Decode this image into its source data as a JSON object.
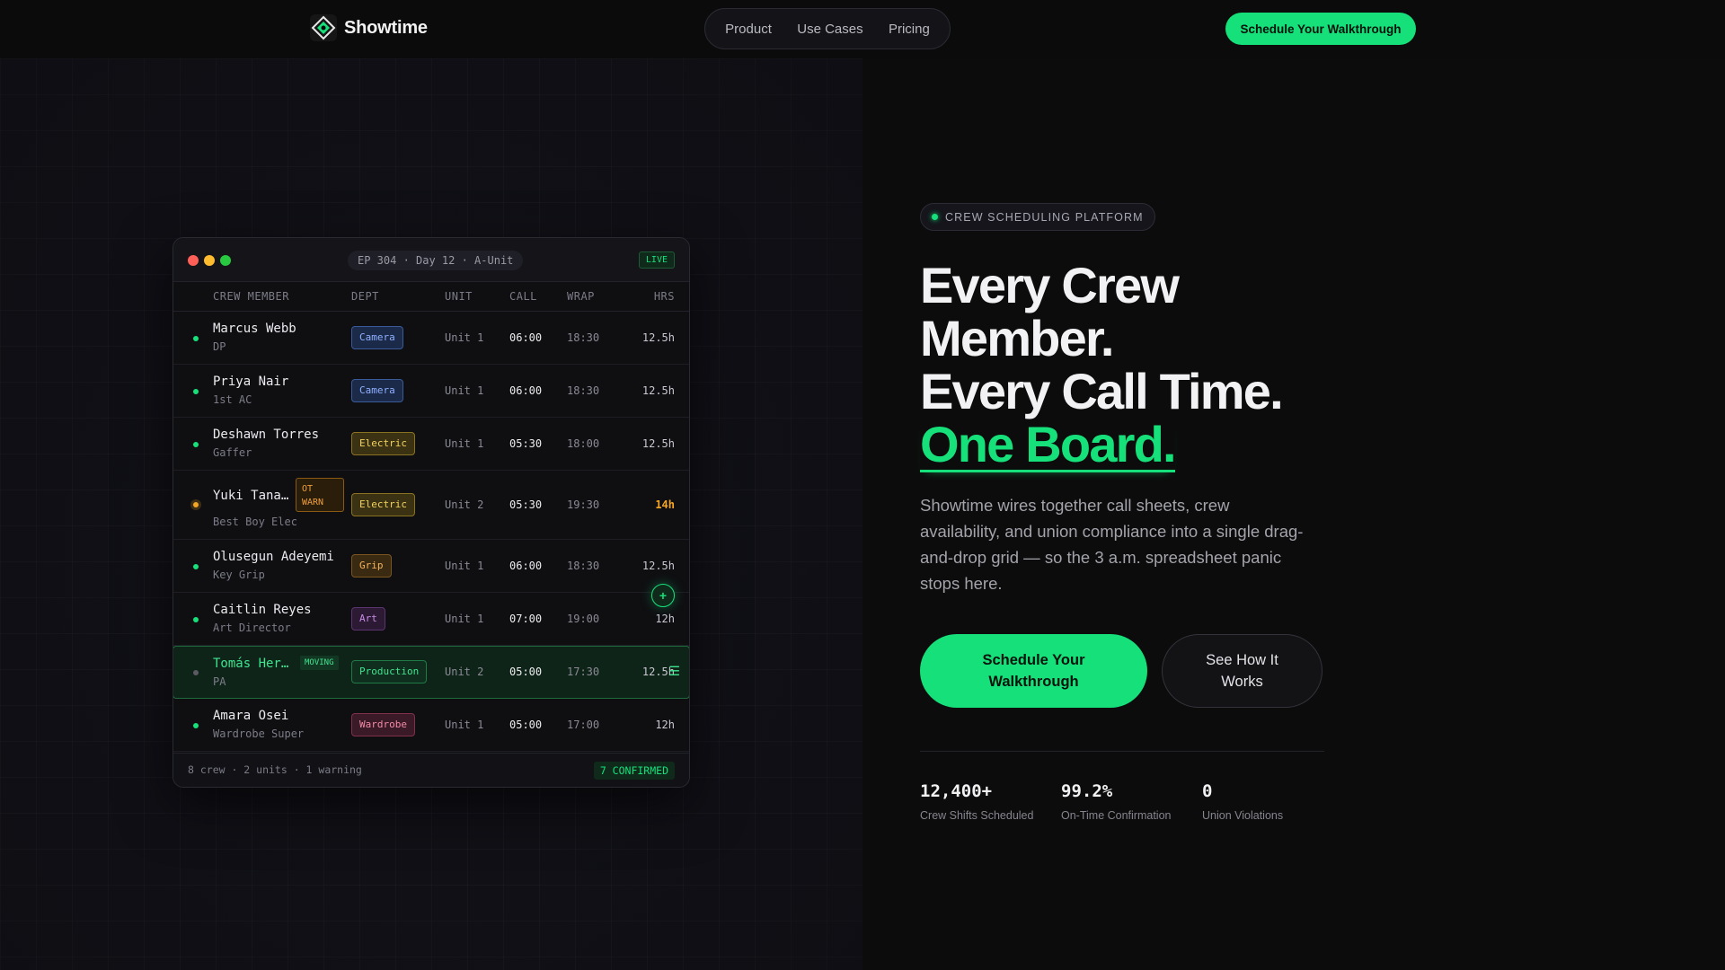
{
  "nav": {
    "brand": "Showtime",
    "links": [
      "Product",
      "Use Cases",
      "Pricing"
    ],
    "cta": "Schedule Your Walkthrough"
  },
  "board": {
    "episode": "EP 304 · Day 12 · A-Unit",
    "live": "LIVE",
    "columns": [
      "CREW MEMBER",
      "DEPT",
      "UNIT",
      "CALL",
      "WRAP",
      "HRS"
    ],
    "rows": [
      {
        "name": "Marcus Webb",
        "role": "DP",
        "dept": "Camera",
        "unit": "Unit 1",
        "call": "06:00",
        "wrap": "18:30",
        "hrs": "12.5h"
      },
      {
        "name": "Priya Nair",
        "role": "1st AC",
        "dept": "Camera",
        "unit": "Unit 1",
        "call": "06:00",
        "wrap": "18:30",
        "hrs": "12.5h"
      },
      {
        "name": "Deshawn Torres",
        "role": "Gaffer",
        "dept": "Electric",
        "unit": "Unit 1",
        "call": "05:30",
        "wrap": "18:00",
        "hrs": "12.5h"
      },
      {
        "name": "Yuki Tana…",
        "role": "Best Boy Elec",
        "dept": "Electric",
        "unit": "Unit 2",
        "call": "05:30",
        "wrap": "19:30",
        "hrs": "14h",
        "flag": "OT WARN"
      },
      {
        "name": "Olusegun Adeyemi",
        "role": "Key Grip",
        "dept": "Grip",
        "unit": "Unit 1",
        "call": "06:00",
        "wrap": "18:30",
        "hrs": "12.5h"
      },
      {
        "name": "Caitlin Reyes",
        "role": "Art Director",
        "dept": "Art",
        "unit": "Unit 1",
        "call": "07:00",
        "wrap": "19:00",
        "hrs": "12h"
      },
      {
        "name": "Tomás Her…",
        "role": "PA",
        "dept": "Production",
        "unit": "Unit 2",
        "call": "05:00",
        "wrap": "17:30",
        "hrs": "12.5h",
        "flag": "MOVING"
      },
      {
        "name": "Amara Osei",
        "role": "Wardrobe Super",
        "dept": "Wardrobe",
        "unit": "Unit 1",
        "call": "05:00",
        "wrap": "17:00",
        "hrs": "12h"
      }
    ],
    "footer": "8 crew · 2 units · 1 warning",
    "confirmed": "7 CONFIRMED",
    "add_symbol": "+"
  },
  "hero": {
    "eyebrow": "CREW SCHEDULING PLATFORM",
    "line1": "Every Crew",
    "line2": "Member.",
    "line3": "Every Call Time.",
    "accent": "One Board.",
    "sub": "Showtime wires together call sheets, crew availability, and union compliance into a single drag-and-drop grid — so the 3 a.m. spreadsheet panic stops here.",
    "cta_primary": "Schedule Your Walkthrough",
    "cta_secondary": "See How It Works"
  },
  "stats": [
    {
      "value": "12,400+",
      "label": "Crew Shifts Scheduled"
    },
    {
      "value": "99.2%",
      "label": "On-Time Confirmation"
    },
    {
      "value": "0",
      "label": "Union Violations"
    }
  ],
  "colors": {
    "accent": "#16e07a",
    "warning": "#f5a524",
    "background": "#0c0c0c"
  }
}
